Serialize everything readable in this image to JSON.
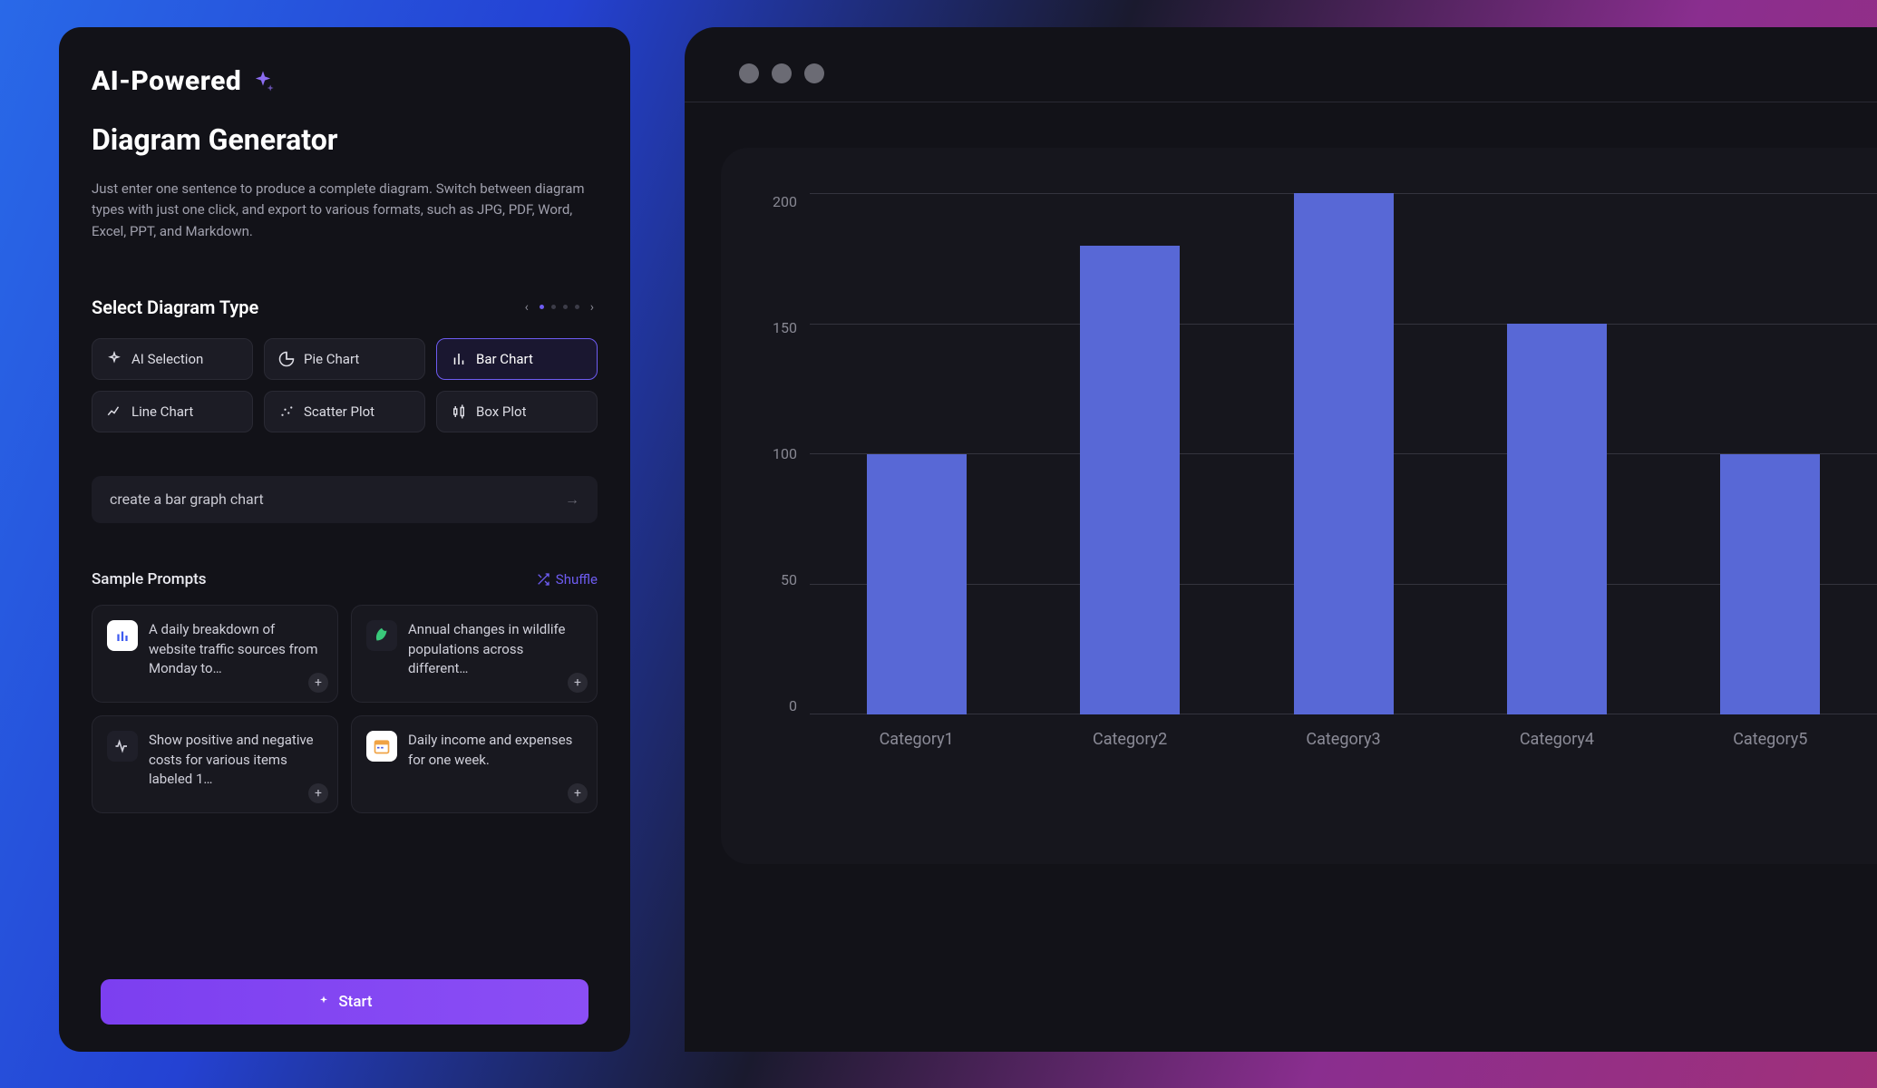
{
  "brand": {
    "label": "AI-Powered"
  },
  "header": {
    "title": "Diagram Generator",
    "description": "Just enter one sentence to produce a complete diagram. Switch between diagram types with just one click, and export to various formats, such as JPG, PDF, Word, Excel, PPT, and Markdown."
  },
  "type_section": {
    "heading": "Select Diagram Type",
    "options": [
      {
        "id": "ai",
        "label": "AI Selection",
        "active": false
      },
      {
        "id": "pie",
        "label": "Pie Chart",
        "active": false
      },
      {
        "id": "bar",
        "label": "Bar Chart",
        "active": true
      },
      {
        "id": "line",
        "label": "Line Chart",
        "active": false
      },
      {
        "id": "scatter",
        "label": "Scatter Plot",
        "active": false
      },
      {
        "id": "box",
        "label": "Box Plot",
        "active": false
      }
    ]
  },
  "input": {
    "value": "create a bar graph chart"
  },
  "samples": {
    "heading": "Sample Prompts",
    "shuffle_label": "Shuffle",
    "items": [
      {
        "icon": "bar-chart-icon",
        "text": "A daily breakdown of website traffic sources from Monday to…"
      },
      {
        "icon": "leaf-icon",
        "text": "Annual changes in wildlife populations across different…"
      },
      {
        "icon": "waveform-icon",
        "text": "Show positive and negative costs for various items labeled 1…"
      },
      {
        "icon": "calendar-icon",
        "text": "Daily income and expenses for one week."
      }
    ]
  },
  "start_button": {
    "label": "Start"
  },
  "chart_data": {
    "type": "bar",
    "categories": [
      "Category1",
      "Category2",
      "Category3",
      "Category4",
      "Category5"
    ],
    "values": [
      100,
      180,
      200,
      150,
      100
    ],
    "ylim": [
      0,
      200
    ],
    "yticks": [
      200,
      150,
      100,
      50,
      0
    ],
    "title": "",
    "xlabel": "",
    "ylabel": ""
  }
}
